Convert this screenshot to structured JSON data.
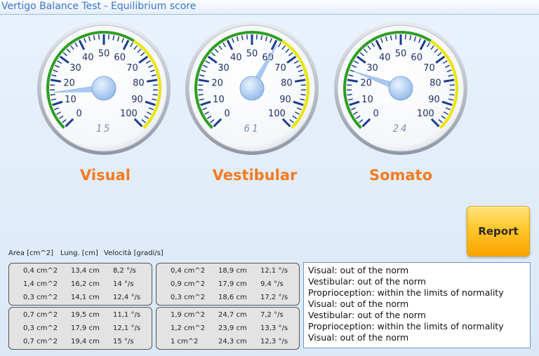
{
  "window": {
    "title": "Vertigo Balance Test - Equilibrium score"
  },
  "gauges": [
    {
      "id": "visual",
      "label": "Visual",
      "value": 15,
      "readout": "15",
      "ticks": [
        "0",
        "10",
        "20",
        "30",
        "40",
        "50",
        "60",
        "70",
        "80",
        "90",
        "100"
      ]
    },
    {
      "id": "vestibular",
      "label": "Vestibular",
      "value": 61,
      "readout": "61",
      "ticks": [
        "0",
        "10",
        "20",
        "30",
        "40",
        "50",
        "60",
        "70",
        "80",
        "90",
        "100"
      ]
    },
    {
      "id": "somato",
      "label": "Somato",
      "value": 24,
      "readout": "24",
      "ticks": [
        "0",
        "10",
        "20",
        "30",
        "40",
        "50",
        "60",
        "70",
        "80",
        "90",
        "100"
      ]
    }
  ],
  "colors": {
    "accent_label": "#f47b20",
    "green_zone": "#2e9e21",
    "yellow_zone": "#e9e600",
    "needle": "#a9c9f2",
    "tick": "#1b3d8f"
  },
  "report_button": {
    "label": "Report"
  },
  "table": {
    "headers": {
      "area": "Area [cm^2]",
      "length": "Lung. [cm]",
      "velocity": "Velocità [gradi/s]"
    },
    "panels": [
      {
        "rows": [
          [
            "0,4 cm^2",
            "13,4 cm",
            "8,2 °/s"
          ],
          [
            "1,4 cm^2",
            "16,2 cm",
            "14 °/s"
          ],
          [
            "0,3 cm^2",
            "14,1 cm",
            "12,4 °/s"
          ]
        ]
      },
      {
        "rows": [
          [
            "0,4 cm^2",
            "18,9 cm",
            "12,1 °/s"
          ],
          [
            "0,9 cm^2",
            "17,9 cm",
            "9,4 °/s"
          ],
          [
            "0,3 cm^2",
            "18,6 cm",
            "17,2 °/s"
          ]
        ]
      },
      {
        "rows": [
          [
            "0,7 cm^2",
            "19,5 cm",
            "11,1 °/s"
          ],
          [
            "0,3 cm^2",
            "17,9 cm",
            "12,1 °/s"
          ],
          [
            "0,7 cm^2",
            "19,4 cm",
            "15 °/s"
          ]
        ]
      },
      {
        "rows": [
          [
            "1,9 cm^2",
            "24,7 cm",
            "7,2 °/s"
          ],
          [
            "1,2 cm^2",
            "23,9 cm",
            "13,3 °/s"
          ],
          [
            "1 cm^2",
            "24,3 cm",
            "12,3 °/s"
          ]
        ]
      }
    ]
  },
  "log": {
    "lines": [
      "Visual: out of the norm",
      "Vestibular: out of the norm",
      "Proprioception: within the limits of normality",
      "Visual: out of the norm",
      "Vestibular: out of the norm",
      "Proprioception: within the limits of normality",
      "Visual: out of the norm"
    ]
  }
}
